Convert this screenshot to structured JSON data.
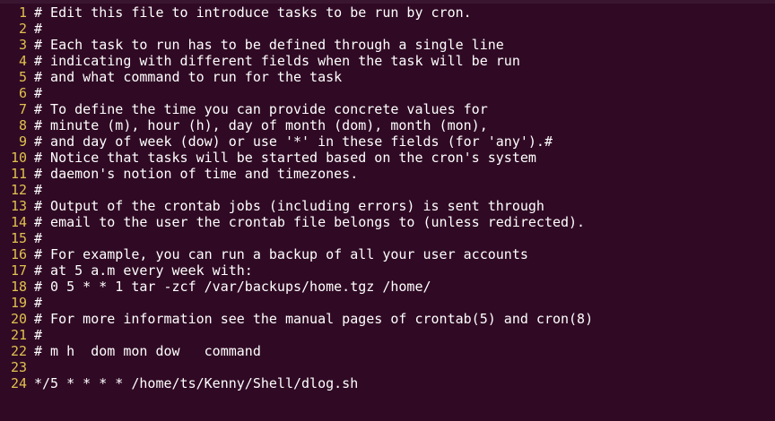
{
  "editor": {
    "lines": [
      {
        "num": "1",
        "text": "# Edit this file to introduce tasks to be run by cron."
      },
      {
        "num": "2",
        "text": "#"
      },
      {
        "num": "3",
        "text": "# Each task to run has to be defined through a single line"
      },
      {
        "num": "4",
        "text": "# indicating with different fields when the task will be run"
      },
      {
        "num": "5",
        "text": "# and what command to run for the task"
      },
      {
        "num": "6",
        "text": "#"
      },
      {
        "num": "7",
        "text": "# To define the time you can provide concrete values for"
      },
      {
        "num": "8",
        "text": "# minute (m), hour (h), day of month (dom), month (mon),"
      },
      {
        "num": "9",
        "text": "# and day of week (dow) or use '*' in these fields (for 'any').#"
      },
      {
        "num": "10",
        "text": "# Notice that tasks will be started based on the cron's system"
      },
      {
        "num": "11",
        "text": "# daemon's notion of time and timezones."
      },
      {
        "num": "12",
        "text": "#"
      },
      {
        "num": "13",
        "text": "# Output of the crontab jobs (including errors) is sent through"
      },
      {
        "num": "14",
        "text": "# email to the user the crontab file belongs to (unless redirected)."
      },
      {
        "num": "15",
        "text": "#"
      },
      {
        "num": "16",
        "text": "# For example, you can run a backup of all your user accounts"
      },
      {
        "num": "17",
        "text": "# at 5 a.m every week with:"
      },
      {
        "num": "18",
        "text": "# 0 5 * * 1 tar -zcf /var/backups/home.tgz /home/"
      },
      {
        "num": "19",
        "text": "#"
      },
      {
        "num": "20",
        "text": "# For more information see the manual pages of crontab(5) and cron(8)"
      },
      {
        "num": "21",
        "text": "#"
      },
      {
        "num": "22",
        "text": "# m h  dom mon dow   command"
      },
      {
        "num": "23",
        "text": ""
      },
      {
        "num": "24",
        "text": "*/5 * * * * /home/ts/Kenny/Shell/dlog.sh"
      }
    ]
  },
  "colors": {
    "background": "#300a24",
    "line_number": "#e0c050",
    "text": "#ffffff"
  }
}
